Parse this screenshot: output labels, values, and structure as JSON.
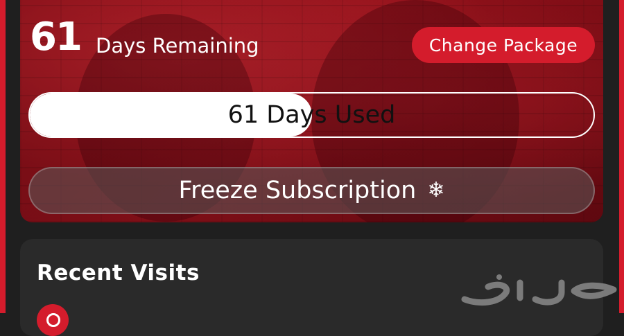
{
  "subscription": {
    "days_remaining_number": "61",
    "days_remaining_label": "Days Remaining",
    "change_package_label": "Change Package",
    "progress_label": "61 Days Used",
    "progress_fraction": 0.5,
    "freeze_label": "Freeze Subscription",
    "freeze_icon": "snowflake-icon"
  },
  "recent_visits": {
    "title": "Recent Visits",
    "icon": "location-pin-icon"
  },
  "watermark": {
    "text": "حراج"
  },
  "colors": {
    "accent": "#d41c2c",
    "background": "#1f1f1f",
    "card": "#2a2a2a"
  }
}
